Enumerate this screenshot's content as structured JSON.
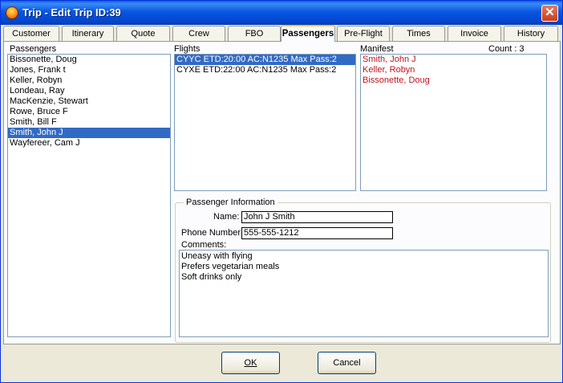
{
  "window": {
    "title": "Trip - Edit Trip ID:39",
    "close_glyph": "✕"
  },
  "tabs": [
    {
      "label": "Customer",
      "active": false
    },
    {
      "label": "Itinerary",
      "active": false
    },
    {
      "label": "Quote",
      "active": false
    },
    {
      "label": "Crew",
      "active": false
    },
    {
      "label": "FBO",
      "active": false
    },
    {
      "label": "Passengers",
      "active": true
    },
    {
      "label": "Pre-Flight",
      "active": false
    },
    {
      "label": "Times",
      "active": false
    },
    {
      "label": "Invoice",
      "active": false
    },
    {
      "label": "History",
      "active": false
    }
  ],
  "passengers": {
    "label": "Passengers",
    "items": [
      "Bissonette, Doug",
      "Jones, Frank t",
      "Keller, Robyn",
      "Londeau, Ray",
      "MacKenzie, Stewart",
      "Rowe, Bruce F",
      "Smith, Bill F",
      "Smith, John J",
      "Wayfereer, Cam J"
    ],
    "selected_index": 7
  },
  "flights": {
    "label": "Flights",
    "items": [
      "CYYC ETD:20:00 AC:N1235 Max Pass:2",
      "CYXE ETD:22:00 AC:N1235 Max Pass:2"
    ],
    "selected_index": 0
  },
  "manifest": {
    "label": "Manifest",
    "count_label": "Count : 3",
    "items": [
      "Smith, John J",
      "Keller, Robyn",
      "Bissonette, Doug"
    ],
    "text_color": "#c0141e"
  },
  "passenger_info": {
    "legend": "Passenger Information",
    "name_label": "Name:",
    "name_value": "John J Smith",
    "phone_label": "Phone Number:",
    "phone_value": "555-555-1212",
    "comments_label": "Comments:",
    "comments_lines": [
      "Uneasy with flying",
      "Prefers vegetarian meals",
      "Soft drinks only"
    ]
  },
  "buttons": {
    "ok_label": "OK",
    "cancel_label": "Cancel"
  },
  "colors": {
    "selection": "#316ac5",
    "titlebar": "#0856e0"
  }
}
